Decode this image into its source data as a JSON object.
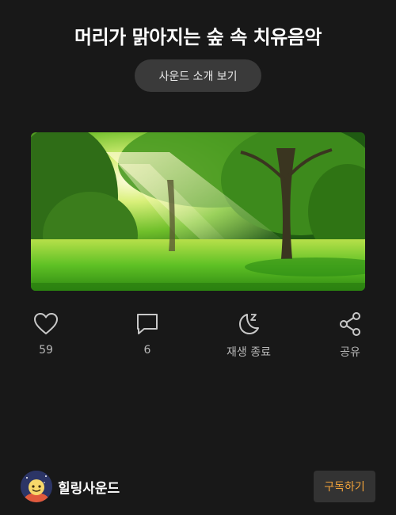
{
  "header": {
    "title": "머리가 맑아지는 숲 속 치유음악",
    "intro_button_label": "사운드 소개 보기"
  },
  "cover": {
    "image_name": "forest-sunlight-cover"
  },
  "actions": [
    {
      "icon": "heart-icon",
      "label": "59"
    },
    {
      "icon": "comment-icon",
      "label": "6"
    },
    {
      "icon": "moon-sleep-icon",
      "label": "재생 종료"
    },
    {
      "icon": "share-icon",
      "label": "공유"
    }
  ],
  "author": {
    "name": "힐링사운드",
    "avatar_icon": "avatar-icon"
  },
  "subscribe": {
    "label": "구독하기",
    "color": "#f0a23a"
  }
}
